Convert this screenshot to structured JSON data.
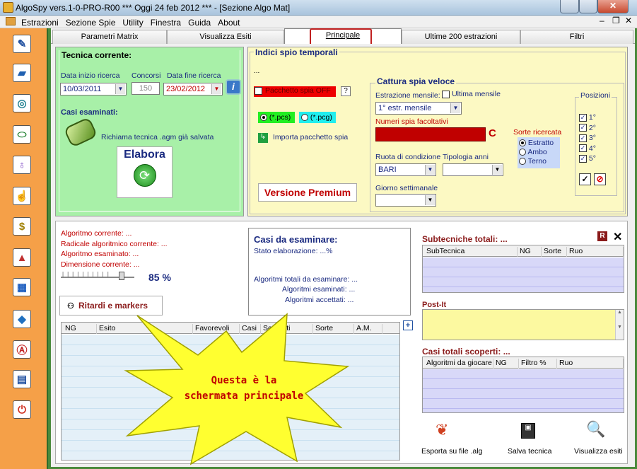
{
  "window": {
    "title": "AlgoSpy vers.1-0-PRO-R00  ***  Oggi 24 feb 2012  ***  - [Sezione Algo Mat]"
  },
  "menu": [
    "Estrazioni",
    "Sezione Spie",
    "Utility",
    "Finestra",
    "Guida",
    "About"
  ],
  "tabs": [
    "Parametri Matrix",
    "Visualizza Esiti",
    "Principale",
    "Ultime 200 estrazioni",
    "Filtri"
  ],
  "toolbar_icons": [
    "pencil-icon",
    "eraser-icon",
    "compass-icon",
    "bullet-icon",
    "bulb-icon",
    "thumb-icon",
    "dollar-icon",
    "pyramid-icon",
    "calendar-icon",
    "diamond-icon",
    "letter-a-icon",
    "book-icon",
    "power-icon"
  ],
  "tecnica": {
    "title": "Tecnica corrente:",
    "data_inizio_label": "Data inizio ricerca",
    "data_inizio": "10/03/2011",
    "concorsi_label": "Concorsi",
    "concorsi": "150",
    "data_fine_label": "Data fine ricerca",
    "data_fine": "23/02/2012",
    "casi_label": "Casi esaminati:",
    "richiama": "Richiama tecnica .agm già salvata",
    "elabora": "Elabora"
  },
  "indici": {
    "title": "Indici spio temporali",
    "dots": "...",
    "pacchetto": "Pacchetto spia OFF",
    "help": "?",
    "pcs": "(*.pcs)",
    "pcg": "(*.pcg)",
    "importa": "Importa pacchetto spia",
    "premium": "Versione Premium"
  },
  "cattura": {
    "title": "Cattura spia veloce",
    "estrazione_label": "Estrazione mensile:",
    "ultima_label": "Ultima mensile",
    "estrazione_val": "1° estr. mensile",
    "numeri_label": "Numeri spia facoltativi",
    "c": "C",
    "ruota_label": "Ruota di condizione",
    "ruota_val": "BARI",
    "tipologia_label": "Tipologia anni",
    "giorno_label": "Giorno settimanale",
    "sorte_label": "Sorte ricercata",
    "sorti": [
      "Estratto",
      "Ambo",
      "Terno"
    ],
    "posizioni_label": "Posizioni",
    "posizioni": [
      "1°",
      "2°",
      "3°",
      "4°",
      "5°"
    ]
  },
  "algoritmo": {
    "corrente": "Algoritmo corrente: ...",
    "radicale": "Radicale algoritmico corrente:  ...",
    "esaminato": "Algoritmo esaminato:  ...",
    "dimensione": "Dimensione corrente:  ...",
    "percent": "85 %",
    "slider_value": 0.85,
    "ritardi": "Ritardi e markers"
  },
  "casi": {
    "title": "Casi da esaminare:",
    "stato": "Stato elaborazione: ...%",
    "totali": "Algoritmi totali da esaminare:  ...",
    "esaminati": "Algoritmi esaminati:  ...",
    "accettati": "Algoritmi accettati:  ..."
  },
  "esiti_grid": {
    "cols": [
      "NG",
      "Esito",
      "Favorevoli",
      "Casi",
      "Scoperti",
      "Sorte",
      "A.M."
    ]
  },
  "subtecniche": {
    "title": "Subtecniche totali:  ...",
    "r": "R",
    "x": "✕",
    "cols": [
      "SubTecnica",
      "NG",
      "Sorte",
      "Ruo"
    ]
  },
  "postit": {
    "title": "Post-It"
  },
  "casi_scoperti": {
    "title": "Casi totali scoperti:  ...",
    "cols": [
      "Algoritmi da giocare",
      "NG",
      "Filtro %",
      "Ruo"
    ]
  },
  "bottom_buttons": [
    "Esporta su file .alg",
    "Salva tecnica",
    "Visualizza esiti"
  ],
  "callout": {
    "line1": "Questa è la",
    "line2": "schermata principale"
  },
  "colors": {
    "green_panel": "#a8f0a8",
    "yellow_panel": "#fcf9c3",
    "toolbar": "#f5a048",
    "frame": "#4a8a3c",
    "red_field": "#c00000"
  }
}
